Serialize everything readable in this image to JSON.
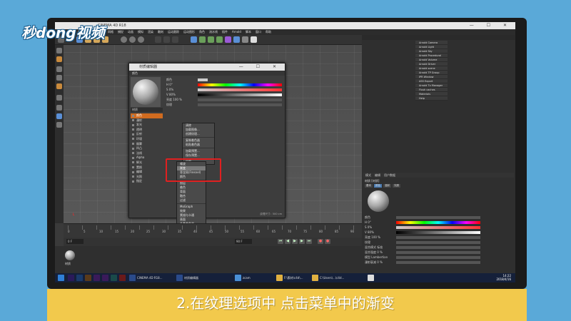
{
  "brand": {
    "logo_text": "秒dong视频"
  },
  "app": {
    "title": "CINEMA 4D R18",
    "menus": [
      "文件",
      "编辑",
      "创建",
      "选择",
      "工具",
      "网格",
      "捕捉",
      "动画",
      "模拟",
      "渲染",
      "雕刻",
      "运动跟踪",
      "运动图形",
      "角色",
      "流水线",
      "插件",
      "Arnold",
      "脚本",
      "窗口",
      "帮助"
    ]
  },
  "material_editor": {
    "title": "材质编辑器",
    "menu_label": "颜色",
    "material_name": "材质",
    "channels": [
      {
        "label": "颜色",
        "selected": true
      },
      {
        "label": "漫射",
        "selected": false
      },
      {
        "label": "发光",
        "selected": false
      },
      {
        "label": "透明",
        "selected": false
      },
      {
        "label": "反射",
        "selected": false
      },
      {
        "label": "环境",
        "selected": false
      },
      {
        "label": "烟雾",
        "selected": false
      },
      {
        "label": "凹凸",
        "selected": false
      },
      {
        "label": "法线",
        "selected": false
      },
      {
        "label": "Alpha",
        "selected": false
      },
      {
        "label": "辉光",
        "selected": false
      },
      {
        "label": "置换",
        "selected": false
      },
      {
        "label": "编辑",
        "selected": false
      },
      {
        "label": "光照",
        "selected": false
      },
      {
        "label": "指定",
        "selected": false
      }
    ],
    "props": [
      {
        "label": "颜色",
        "kind": "swatch"
      },
      {
        "label": "H  0°",
        "kind": "hue"
      },
      {
        "label": "S  0%",
        "kind": "sat"
      },
      {
        "label": "V  80%",
        "kind": "val"
      },
      {
        "label": "亮度  100 %",
        "kind": "field"
      },
      {
        "label": "纹理",
        "kind": "field"
      }
    ],
    "statusbar": "纹理尺寸：500 cm"
  },
  "context_menu_1": {
    "items": [
      "清除",
      "加载图像...",
      "创建纹理...",
      "复制着色器",
      "粘贴着色器",
      "加载预置...",
      "保存预置...",
      "位图"
    ]
  },
  "context_menu_2": {
    "items": [
      "噪波",
      "渐变",
      "菲涅耳(Fresnel)",
      "颜色",
      "图层",
      "着色",
      "背面",
      "融合",
      "过滤",
      "MoGraph",
      "效果",
      "素描与卡通",
      "表面",
      "多重着色器",
      "多边形生成"
    ],
    "highlighted_index": 1
  },
  "arnold_list": {
    "items": [
      "Arnold Camera",
      "Arnold Light",
      "Arnold Sky",
      "Arnold Procedural",
      "Arnold Volume",
      "Arnold Driver",
      "Arnold scene",
      "Arnold TP Group",
      "IPR Window",
      "ASS Export",
      "Arnold Tx Manager",
      "Flush caches",
      "Materials",
      "Help"
    ]
  },
  "right_panel": {
    "header_tabs": [
      "模式",
      "编辑",
      "用户数据"
    ],
    "mat_tabs": [
      "基本",
      "颜色",
      "漫射",
      "光照"
    ],
    "material_name": "材质 [材质]",
    "props": [
      {
        "label": "颜色"
      },
      {
        "label": "H  0°",
        "kind": "hue"
      },
      {
        "label": "S  0%",
        "kind": "sat"
      },
      {
        "label": "V  80%",
        "kind": "val"
      },
      {
        "label": "亮度  100 %"
      },
      {
        "label": "纹理"
      },
      {
        "label": "混合模式  标准"
      },
      {
        "label": "混合强度  0 %"
      },
      {
        "label": "模型  Lambertian"
      },
      {
        "label": "漫射衰减  0 %"
      }
    ]
  },
  "timeline": {
    "ticks": [
      "0",
      "5",
      "10",
      "15",
      "20",
      "25",
      "30",
      "35",
      "40",
      "45",
      "50",
      "55",
      "60",
      "65",
      "70",
      "75",
      "80",
      "85",
      "90"
    ],
    "start": "0 F",
    "end": "90 F",
    "current": "0 F"
  },
  "bottom_panel": {
    "material_thumb_label": "材质"
  },
  "taskbar": {
    "items": [
      "CINEMA 4D R18...",
      "材质编辑器",
      "zcam",
      "F:\\素材\\c4d\\...",
      "C:\\Users\\...\\c4d..."
    ],
    "time": "14:22",
    "date": "2018/4/16"
  },
  "subtitle": "2.在纹理选项中 点击菜单中的渐变",
  "colors": {
    "accent": "#d06b1f",
    "highlight_box": "#e02020",
    "banner": "#f2c94c",
    "background": "#5aa9d8"
  }
}
